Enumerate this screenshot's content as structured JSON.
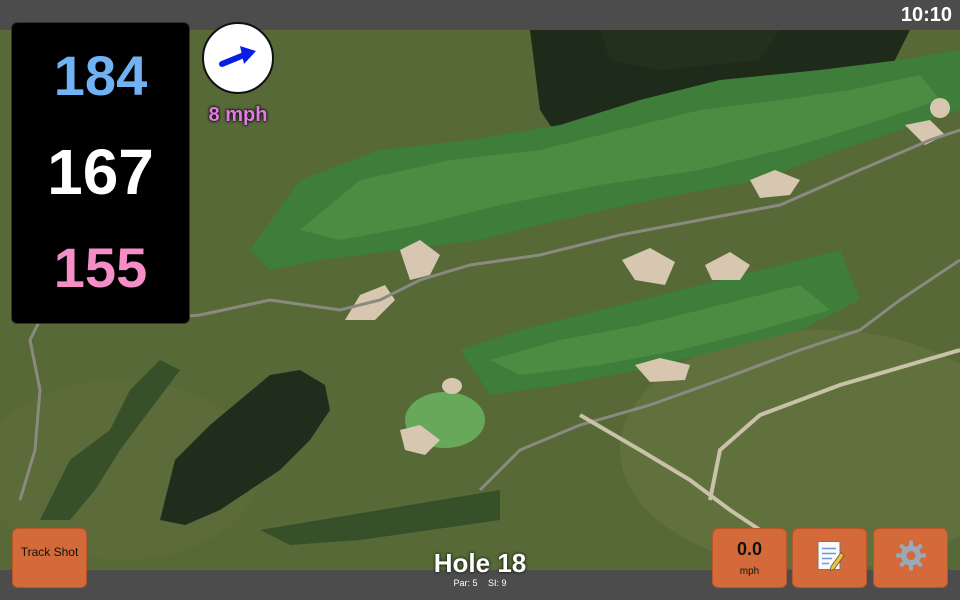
{
  "status": {
    "time": "10:10"
  },
  "distances": {
    "back": "184",
    "middle": "167",
    "front": "155"
  },
  "wind": {
    "speed_label": "8 mph",
    "direction_icon": "arrow-icon"
  },
  "buttons": {
    "track_shot": "Track Shot",
    "speed_value": "0.0",
    "speed_unit": "mph",
    "notes_icon": "notepad-icon",
    "settings_icon": "gear-icon"
  },
  "hole": {
    "title": "Hole 18",
    "par": "Par: 5",
    "si": "SI: 9"
  },
  "colors": {
    "back": "#6fb3f5",
    "middle": "#ffffff",
    "front": "#f58ec7",
    "wind_text": "#e478e8",
    "button": "#d46a3a"
  }
}
